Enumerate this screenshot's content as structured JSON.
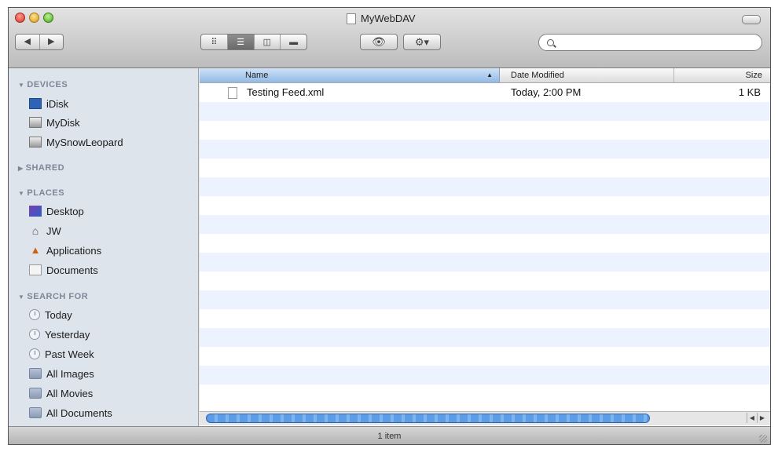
{
  "window": {
    "title": "MyWebDAV"
  },
  "toolbar": {
    "back_glyph": "◀",
    "forward_glyph": "▶",
    "view_icons_glyph": "⠿",
    "view_list_glyph": "☰",
    "view_columns_glyph": "◫",
    "view_coverflow_glyph": "▬",
    "quicklook_glyph": "👁",
    "action_glyph": "⚙▾",
    "search_placeholder": ""
  },
  "sidebar": {
    "devices": {
      "header": "DEVICES",
      "items": [
        {
          "label": "iDisk",
          "icon": "idisk-icon"
        },
        {
          "label": "MyDisk",
          "icon": "disk-icon"
        },
        {
          "label": "MySnowLeopard",
          "icon": "disk-icon"
        }
      ]
    },
    "shared": {
      "header": "SHARED"
    },
    "places": {
      "header": "PLACES",
      "items": [
        {
          "label": "Desktop",
          "icon": "desktop-icon"
        },
        {
          "label": "JW",
          "icon": "home-icon"
        },
        {
          "label": "Applications",
          "icon": "applications-icon"
        },
        {
          "label": "Documents",
          "icon": "documents-icon"
        }
      ]
    },
    "search_for": {
      "header": "SEARCH FOR",
      "items": [
        {
          "label": "Today",
          "icon": "clock-icon"
        },
        {
          "label": "Yesterday",
          "icon": "clock-icon"
        },
        {
          "label": "Past Week",
          "icon": "clock-icon"
        },
        {
          "label": "All Images",
          "icon": "smart-folder-icon"
        },
        {
          "label": "All Movies",
          "icon": "smart-folder-icon"
        },
        {
          "label": "All Documents",
          "icon": "smart-folder-icon"
        }
      ]
    }
  },
  "columns": {
    "name": "Name",
    "date": "Date Modified",
    "size": "Size"
  },
  "files": [
    {
      "name": "Testing Feed.xml",
      "date": "Today, 2:00 PM",
      "size": "1 KB"
    }
  ],
  "status": {
    "text": "1 item"
  },
  "colors": {
    "sidebar_bg": "#dde4ec",
    "selected_column": "#92b9e6",
    "row_stripe": "#edf3fe",
    "scroll_thumb": "#5d9de6"
  }
}
